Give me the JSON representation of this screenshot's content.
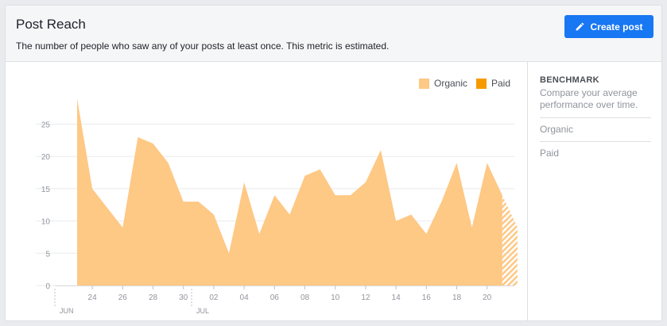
{
  "header": {
    "title": "Post Reach",
    "subtitle": "The number of people who saw any of your posts at least once. This metric is estimated.",
    "create_label": "Create post"
  },
  "legend": {
    "organic": "Organic",
    "paid": "Paid"
  },
  "sidebar": {
    "title": "BENCHMARK",
    "description": "Compare your average performance over time.",
    "items": [
      "Organic",
      "Paid"
    ]
  },
  "colors": {
    "organic": "#fec885",
    "paid": "#f79a00",
    "accent": "#1877f2",
    "grid": "#e9ebee",
    "axis": "#90949c"
  },
  "icons": {
    "create": "pencil-icon"
  },
  "chart_data": {
    "type": "area",
    "series": [
      {
        "name": "Organic",
        "values": [
          29,
          15,
          12,
          9,
          23,
          22,
          19,
          13,
          13,
          11,
          5,
          16,
          8,
          14,
          11,
          17,
          18,
          14,
          14,
          16,
          21,
          10,
          11,
          8,
          13,
          19,
          9,
          19,
          14,
          9
        ]
      },
      {
        "name": "Paid",
        "values": [
          0,
          0,
          0,
          0,
          0,
          0,
          0,
          0,
          0,
          0,
          0,
          0,
          0,
          0,
          0,
          0,
          0,
          0,
          0,
          0,
          0,
          0,
          0,
          0,
          0,
          0,
          0,
          0,
          0,
          0
        ]
      }
    ],
    "x_start_day": 23,
    "x_tick_labels": [
      "24",
      "26",
      "28",
      "30",
      "02",
      "04",
      "06",
      "08",
      "10",
      "12",
      "14",
      "16",
      "18",
      "20"
    ],
    "month_labels": [
      "JUN",
      "JUL"
    ],
    "y_ticks": [
      0,
      5,
      10,
      15,
      20,
      25
    ],
    "ylim": [
      0,
      29
    ],
    "grid": true,
    "legend_position": "top-right",
    "estimated_last_point": true
  }
}
